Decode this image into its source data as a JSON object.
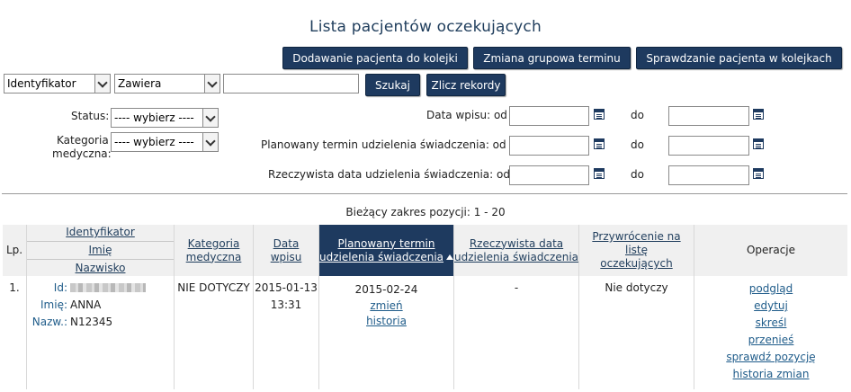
{
  "page": {
    "title": "Lista pacjentów oczekujących"
  },
  "actions": {
    "add_patient": "Dodawanie pacjenta do kolejki",
    "group_change": "Zmiana grupowa terminu",
    "check_patient": "Sprawdzanie pacjenta w kolejkach"
  },
  "search": {
    "field_select": "Identyfikator",
    "mode_select": "Zawiera",
    "query": "",
    "search_button": "Szukaj",
    "count_button": "Zlicz rekordy"
  },
  "filters": {
    "status_label": "Status:",
    "status_value": "---- wybierz ----",
    "category_label_1": "Kategoria",
    "category_label_2": "medyczna:",
    "category_value": "---- wybierz ----",
    "entry_date_label": "Data wpisu: od",
    "planned_label": "Planowany termin udzielenia świadczenia: od",
    "actual_label": "Rzeczywista data udzielenia świadczenia: od",
    "to_label": "do"
  },
  "range_text": "Bieżący zakres pozycji: 1 - 20",
  "table": {
    "headers": {
      "lp": "Lp.",
      "identifier": "Identyfikator",
      "first_name": "Imię",
      "last_name": "Nazwisko",
      "category_1": "Kategoria",
      "category_2": "medyczna",
      "entry_1": "Data",
      "entry_2": "wpisu",
      "planned_1": "Planowany termin",
      "planned_2": "udzielenia świadczenia",
      "actual_1": "Rzeczywista data",
      "actual_2": "udzielenia świadczenia",
      "restore_1": "Przywrócenie na listę",
      "restore_2": "oczekujących",
      "operations": "Operacje"
    },
    "rows": [
      {
        "lp": "1.",
        "id_label": "Id:",
        "first_label": "Imię:",
        "first_name": "ANNA",
        "last_label": "Nazw.:",
        "last_name": "N12345",
        "category": "NIE DOTYCZY",
        "entry_date": "2015-01-13",
        "entry_time": "13:31",
        "planned_date": "2015-02-24",
        "change_link": "zmień",
        "history_link": "historia",
        "actual_date": "-",
        "restore": "Nie dotyczy",
        "ops": [
          "podgląd",
          "edytuj",
          "skreśl",
          "przenieś",
          "sprawdź pozycję",
          "historia zmian"
        ]
      }
    ]
  }
}
